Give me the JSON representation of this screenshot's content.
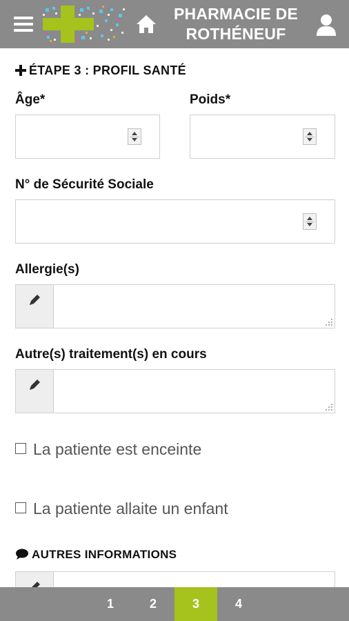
{
  "header": {
    "title_line1": "PHARMACIE DE",
    "title_line2": "ROTHÉNEUF",
    "colors": {
      "bar": "#8a8a8a",
      "logo_green": "#a6c21c"
    }
  },
  "step": {
    "title": "ÉTAPE 3 : PROFIL SANTÉ"
  },
  "fields": {
    "age_label": "Âge*",
    "age_value": "",
    "poids_label": "Poids*",
    "poids_value": "",
    "secu_label": "N° de Sécurité Sociale",
    "secu_value": "",
    "allergies_label": "Allergie(s)",
    "allergies_value": "",
    "traitements_label": "Autre(s) traitement(s) en cours",
    "traitements_value": ""
  },
  "checkboxes": {
    "enceinte_label": "La patiente est enceinte",
    "enceinte_checked": false,
    "allaite_label": "La patiente allaite un enfant",
    "allaite_checked": false
  },
  "autres": {
    "title": "AUTRES INFORMATIONS",
    "value": ""
  },
  "pagination": {
    "pages": [
      "1",
      "2",
      "3",
      "4"
    ],
    "active": "3",
    "colors": {
      "active": "#a6c21c",
      "bar": "#8a8a8a"
    }
  }
}
